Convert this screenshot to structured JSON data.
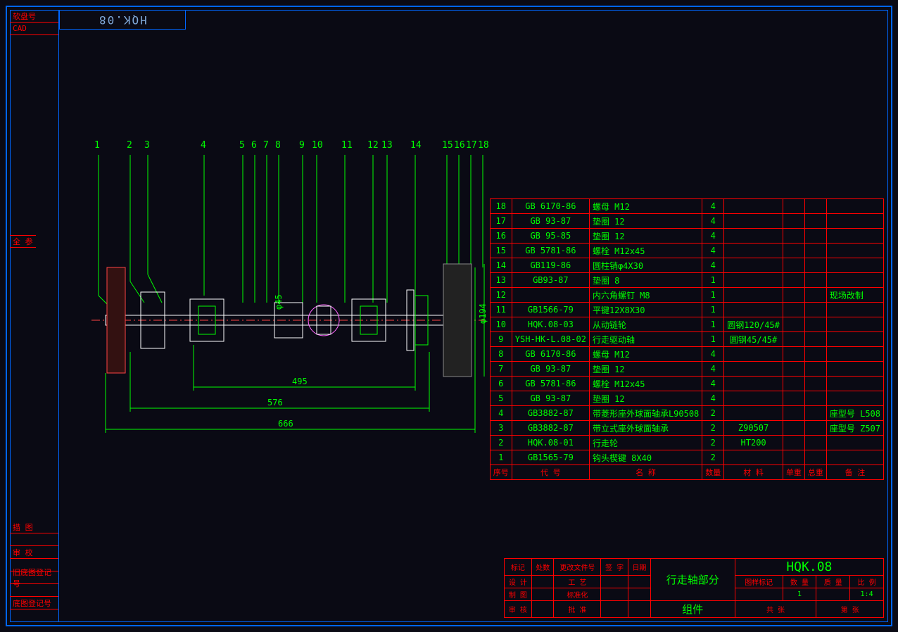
{
  "header": {
    "topLeft1": "软盘号",
    "topLeft2": "CAD",
    "topTabMirror": "HQK.08"
  },
  "leftLabels": {
    "mid": "全 参",
    "b1": "描 图",
    "b2": "审 校",
    "b3": "旧底图登记号",
    "b4": "底图登记号"
  },
  "callouts": [
    "1",
    "2",
    "3",
    "4",
    "5",
    "6",
    "7",
    "8",
    "9",
    "10",
    "11",
    "12",
    "13",
    "14",
    "15",
    "16",
    "17",
    "18"
  ],
  "dimensions": {
    "d1": "495",
    "d2": "576",
    "d3": "666",
    "dia1": "φ45",
    "dia2": "φ194"
  },
  "bom": {
    "header": [
      "序号",
      "代 号",
      "名   称",
      "数量",
      "材  料",
      "单重",
      "总重",
      "备 注"
    ],
    "rows": [
      {
        "n": "18",
        "code": "GB 6170-86",
        "name": "螺母 M12",
        "qty": "4",
        "mat": "",
        "u": "",
        "t": "",
        "note": ""
      },
      {
        "n": "17",
        "code": "GB 93-87",
        "name": "垫圈 12",
        "qty": "4",
        "mat": "",
        "u": "",
        "t": "",
        "note": ""
      },
      {
        "n": "16",
        "code": "GB 95-85",
        "name": "垫圈 12",
        "qty": "4",
        "mat": "",
        "u": "",
        "t": "",
        "note": ""
      },
      {
        "n": "15",
        "code": "GB 5781-86",
        "name": "螺栓  M12x45",
        "qty": "4",
        "mat": "",
        "u": "",
        "t": "",
        "note": ""
      },
      {
        "n": "14",
        "code": "GB119-86",
        "name": "圆柱销φ4X30",
        "qty": "4",
        "mat": "",
        "u": "",
        "t": "",
        "note": ""
      },
      {
        "n": "13",
        "code": "GB93-87",
        "name": "垫圈 8",
        "qty": "1",
        "mat": "",
        "u": "",
        "t": "",
        "note": ""
      },
      {
        "n": "12",
        "code": "",
        "name": "内六角螺钉 M8",
        "qty": "1",
        "mat": "",
        "u": "",
        "t": "",
        "note": "现场改制"
      },
      {
        "n": "11",
        "code": "GB1566-79",
        "name": "平键12X8X30",
        "qty": "1",
        "mat": "",
        "u": "",
        "t": "",
        "note": ""
      },
      {
        "n": "10",
        "code": "HQK.08-03",
        "name": "从动链轮",
        "qty": "1",
        "mat": "圆钢120/45#",
        "u": "",
        "t": "",
        "note": ""
      },
      {
        "n": "9",
        "code": "YSH-HK-L.08-02",
        "name": "行走驱动轴",
        "qty": "1",
        "mat": "圆钢45/45#",
        "u": "",
        "t": "",
        "note": ""
      },
      {
        "n": "8",
        "code": "GB 6170-86",
        "name": "螺母 M12",
        "qty": "4",
        "mat": "",
        "u": "",
        "t": "",
        "note": ""
      },
      {
        "n": "7",
        "code": "GB 93-87",
        "name": "垫圈 12",
        "qty": "4",
        "mat": "",
        "u": "",
        "t": "",
        "note": ""
      },
      {
        "n": "6",
        "code": "GB 5781-86",
        "name": "螺栓  M12x45",
        "qty": "4",
        "mat": "",
        "u": "",
        "t": "",
        "note": ""
      },
      {
        "n": "5",
        "code": "GB 93-87",
        "name": "垫圈 12",
        "qty": "4",
        "mat": "",
        "u": "",
        "t": "",
        "note": ""
      },
      {
        "n": "4",
        "code": "GB3882-87",
        "name": "带菱形座外球面轴承L90508",
        "qty": "2",
        "mat": "",
        "u": "",
        "t": "",
        "note": "座型号 L508"
      },
      {
        "n": "3",
        "code": "GB3882-87",
        "name": "带立式座外球面轴承",
        "qty": "2",
        "mat": "Z90507",
        "u": "",
        "t": "",
        "note": "座型号 Z507"
      },
      {
        "n": "2",
        "code": "HQK.08-01",
        "name": "行走轮",
        "qty": "2",
        "mat": "HT200",
        "u": "",
        "t": "",
        "note": ""
      },
      {
        "n": "1",
        "code": "GB1565-79",
        "name": "钩头楔键 8X40",
        "qty": "2",
        "mat": "",
        "u": "",
        "t": "",
        "note": ""
      }
    ]
  },
  "titleblock": {
    "row1": [
      "标记",
      "处数",
      "更改文件号",
      "签 字",
      "日期"
    ],
    "row2a": "设 计",
    "row2b": "工 艺",
    "row3a": "制 图",
    "row3b": "标准化",
    "row4a": "审 核",
    "row4b": "批 准",
    "name1": "行走轴部分",
    "name2": "组件",
    "drawingNo": "HQK.08",
    "subhdr": [
      "图样标记",
      "数 量",
      "质 量",
      "比 例"
    ],
    "subvals": [
      "1",
      "1:4"
    ],
    "bottomL": "共   张",
    "bottomR": "第   张"
  }
}
